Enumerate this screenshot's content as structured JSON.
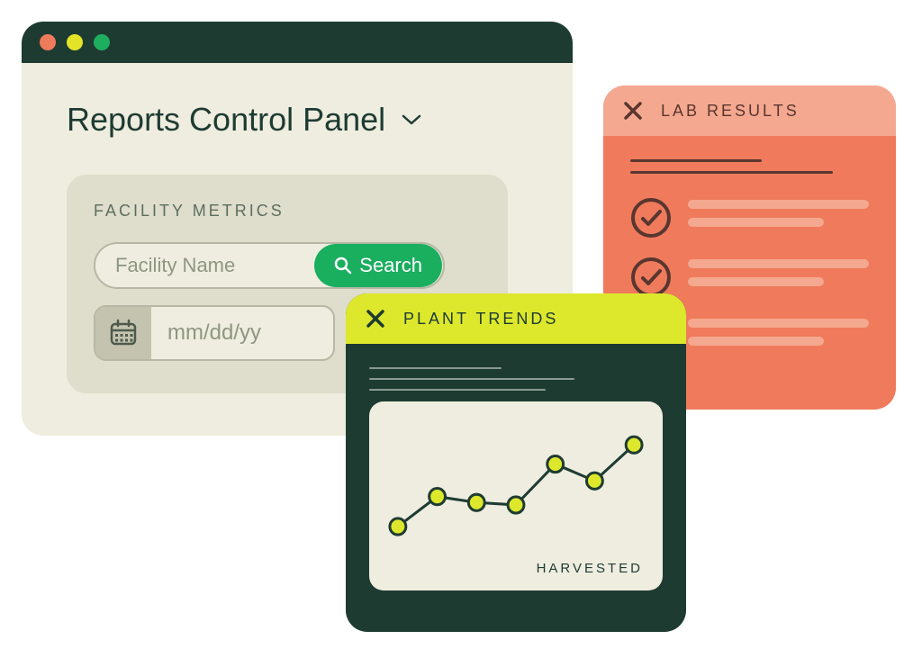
{
  "main": {
    "title": "Reports Control Panel",
    "metrics": {
      "label": "FACILITY METRICS",
      "search_placeholder": "Facility Name",
      "search_button": "Search",
      "date_placeholder": "mm/dd/yy"
    }
  },
  "lab": {
    "title": "LAB RESULTS",
    "items": [
      {
        "status": "check"
      },
      {
        "status": "check"
      },
      {
        "status": "x"
      }
    ]
  },
  "trends": {
    "title": "PLANT TRENDS",
    "chart_label": "HARVESTED"
  },
  "chart_data": {
    "type": "line",
    "title": "Harvested",
    "x": [
      1,
      2,
      3,
      4,
      5,
      6,
      7
    ],
    "values": [
      20,
      45,
      40,
      38,
      72,
      58,
      88
    ],
    "ylim": [
      0,
      100
    ]
  },
  "colors": {
    "dark_green": "#1E3B32",
    "cream": "#EEEDDF",
    "panel": "#DFDDCB",
    "green_btn": "#1AAE5F",
    "lime": "#DDE82C",
    "orange": "#EF7B5C",
    "peach": "#F4A88F",
    "chart_dot": "#DDE82C"
  }
}
